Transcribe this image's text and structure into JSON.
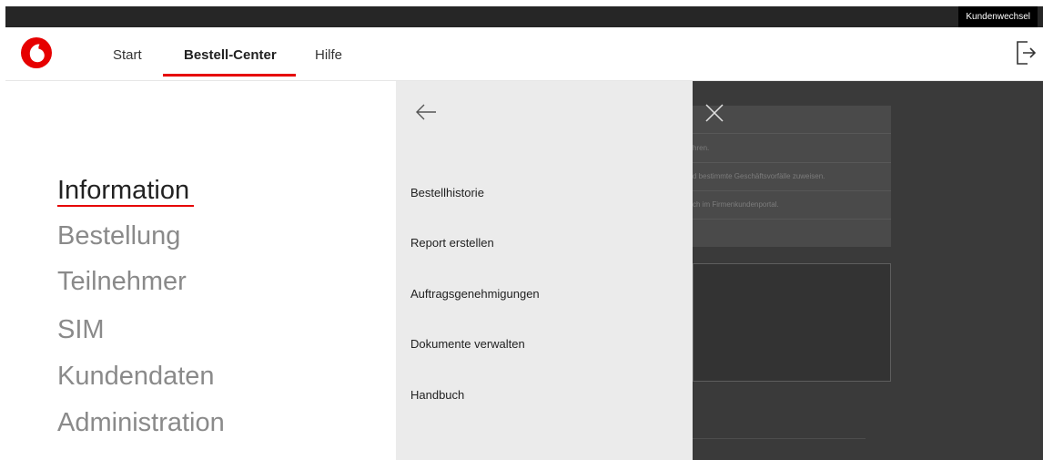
{
  "topbar": {
    "customer_switch_label": "Kundenwechsel"
  },
  "header": {
    "nav": [
      {
        "label": "Start"
      },
      {
        "label": "Bestell-Center"
      },
      {
        "label": "Hilfe"
      }
    ]
  },
  "menu": {
    "main_items": [
      {
        "label": "Information"
      },
      {
        "label": "Bestellung"
      },
      {
        "label": "Teilnehmer"
      },
      {
        "label": "SIM"
      },
      {
        "label": "Kundendaten"
      },
      {
        "label": "Administration"
      }
    ],
    "sub_items": [
      {
        "label": "Bestellhistorie"
      },
      {
        "label": "Report erstellen"
      },
      {
        "label": "Auftragsgenehmigungen"
      },
      {
        "label": "Dokumente verwalten"
      },
      {
        "label": "Handbuch"
      }
    ]
  },
  "background": {
    "lines": [
      "hren.",
      "d bestimmte Geschäftsvorfälle zuweisen.",
      "ch im Firmenkundenportal."
    ]
  },
  "colors": {
    "accent": "#e60000",
    "topbar": "#262626",
    "overlay": "#3a3a3a",
    "subpanel": "#ebebeb"
  },
  "icons": [
    "vodafone-logo",
    "logout-icon",
    "back-arrow-icon",
    "close-icon"
  ]
}
